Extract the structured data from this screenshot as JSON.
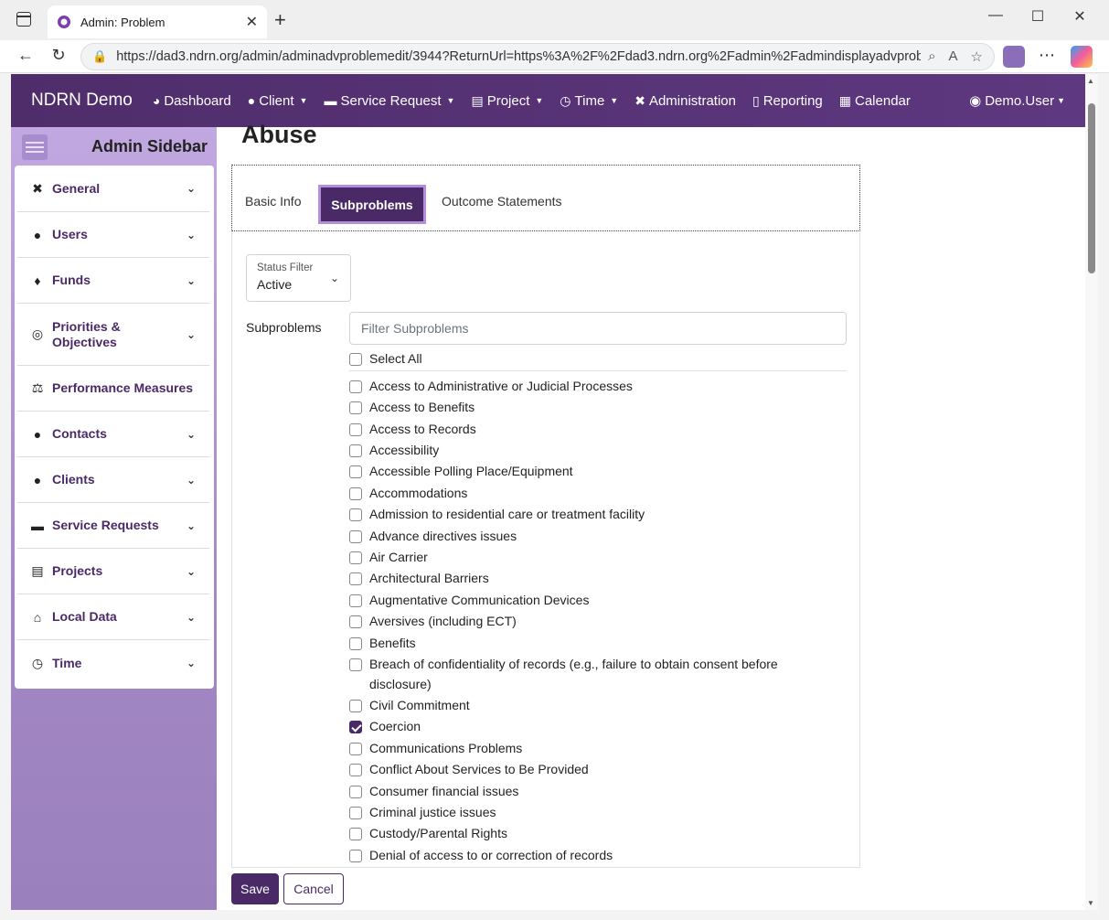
{
  "browser": {
    "tab_title": "Admin: Problem",
    "url": "https://dad3.ndrn.org/admin/adminadvproblemedit/3944?ReturnUrl=https%3A%2F%2Fdad3.ndrn.org%2Fadmin%2Fadmindisplayadvprob..."
  },
  "topnav": {
    "brand": "NDRN Demo",
    "items": [
      {
        "label": "Dashboard",
        "icon": "dashboard-icon",
        "dropdown": false
      },
      {
        "label": "Client",
        "icon": "user-icon",
        "dropdown": true
      },
      {
        "label": "Service Request",
        "icon": "briefcase-icon",
        "dropdown": true
      },
      {
        "label": "Project",
        "icon": "clipboard-icon",
        "dropdown": true
      },
      {
        "label": "Time",
        "icon": "clock-icon",
        "dropdown": true
      },
      {
        "label": "Administration",
        "icon": "tools-icon",
        "dropdown": false
      },
      {
        "label": "Reporting",
        "icon": "file-icon",
        "dropdown": false
      },
      {
        "label": "Calendar",
        "icon": "calendar-icon",
        "dropdown": false
      }
    ],
    "user": "Demo.User"
  },
  "sidebar": {
    "title": "Admin Sidebar",
    "items": [
      {
        "label": "General",
        "icon": "tools-icon"
      },
      {
        "label": "Users",
        "icon": "users-icon"
      },
      {
        "label": "Funds",
        "icon": "money-bag-icon"
      },
      {
        "label": "Priorities & Objectives",
        "icon": "target-icon"
      },
      {
        "label": "Performance Measures",
        "icon": "balance-scale-icon"
      },
      {
        "label": "Contacts",
        "icon": "users-icon"
      },
      {
        "label": "Clients",
        "icon": "user-icon"
      },
      {
        "label": "Service Requests",
        "icon": "briefcase-icon"
      },
      {
        "label": "Projects",
        "icon": "clipboard-icon"
      },
      {
        "label": "Local Data",
        "icon": "house-icon"
      },
      {
        "label": "Time",
        "icon": "clock-icon"
      }
    ]
  },
  "main": {
    "title": "Abuse",
    "tabs": [
      {
        "label": "Basic Info",
        "active": false
      },
      {
        "label": "Subproblems",
        "active": true
      },
      {
        "label": "Outcome Statements",
        "active": false
      }
    ],
    "status_filter": {
      "label": "Status Filter",
      "value": "Active"
    },
    "subproblems_label": "Subproblems",
    "filter_placeholder": "Filter Subproblems",
    "select_all": "Select All",
    "subproblems": [
      {
        "label": "Access to Administrative or Judicial Processes",
        "checked": false
      },
      {
        "label": "Access to Benefits",
        "checked": false
      },
      {
        "label": "Access to Records",
        "checked": false
      },
      {
        "label": "Accessibility",
        "checked": false
      },
      {
        "label": "Accessible Polling Place/Equipment",
        "checked": false
      },
      {
        "label": "Accommodations",
        "checked": false
      },
      {
        "label": "Admission to residential care or treatment facility",
        "checked": false
      },
      {
        "label": "Advance directives issues",
        "checked": false
      },
      {
        "label": "Air Carrier",
        "checked": false
      },
      {
        "label": "Architectural Barriers",
        "checked": false
      },
      {
        "label": "Augmentative Communication Devices",
        "checked": false
      },
      {
        "label": "Aversives (including ECT)",
        "checked": false
      },
      {
        "label": "Benefits",
        "checked": false
      },
      {
        "label": "Breach of confidentiality of records (e.g., failure to obtain consent before disclosure)",
        "checked": false
      },
      {
        "label": "Civil Commitment",
        "checked": false
      },
      {
        "label": "Coercion",
        "checked": true
      },
      {
        "label": "Communications Problems",
        "checked": false
      },
      {
        "label": "Conflict About Services to Be Provided",
        "checked": false
      },
      {
        "label": "Consumer financial issues",
        "checked": false
      },
      {
        "label": "Criminal justice issues",
        "checked": false
      },
      {
        "label": "Custody/Parental Rights",
        "checked": false
      },
      {
        "label": "Denial of access to or correction of records",
        "checked": false
      }
    ],
    "buttons": {
      "save": "Save",
      "cancel": "Cancel"
    }
  },
  "colors": {
    "brand_purple": "#4a2a66",
    "sidebar_bg": "#b49ad6"
  }
}
